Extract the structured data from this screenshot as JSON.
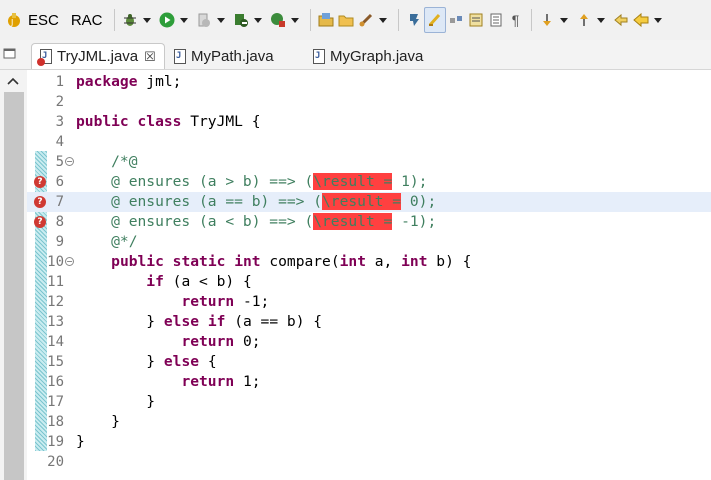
{
  "toolbar": {
    "esc_label": "ESC",
    "rac_label": "RAC"
  },
  "tabs": [
    {
      "label": "TryJML.java",
      "active": true,
      "has_error": true,
      "close_glyph": "☒"
    },
    {
      "label": "MyPath.java",
      "active": false
    },
    {
      "label": "MyGraph.java",
      "active": false
    }
  ],
  "editor": {
    "lines": [
      {
        "num": "1",
        "segments": [
          {
            "t": "kw",
            "v": "package"
          },
          {
            "t": "",
            "v": " jml;"
          }
        ]
      },
      {
        "num": "2",
        "segments": []
      },
      {
        "num": "3",
        "segments": [
          {
            "t": "kw",
            "v": "public"
          },
          {
            "t": "",
            "v": " "
          },
          {
            "t": "kw",
            "v": "class"
          },
          {
            "t": "",
            "v": " TryJML {"
          }
        ]
      },
      {
        "num": "4",
        "segments": []
      },
      {
        "num": "5",
        "segments": [
          {
            "t": "cm",
            "v": "    /*@"
          }
        ]
      },
      {
        "num": "6",
        "segments": [
          {
            "t": "cm",
            "v": "    @ ensures (a > b) ==> ("
          },
          {
            "t": "err",
            "v": "\\result ="
          },
          {
            "t": "cm",
            "v": " 1);"
          }
        ]
      },
      {
        "num": "7",
        "segments": [
          {
            "t": "cm",
            "v": "    @ ensures (a == b) ==> ("
          },
          {
            "t": "err",
            "v": "\\result ="
          },
          {
            "t": "cm",
            "v": " 0);"
          }
        ]
      },
      {
        "num": "8",
        "segments": [
          {
            "t": "cm",
            "v": "    @ ensures (a < b) ==> ("
          },
          {
            "t": "err",
            "v": "\\result ="
          },
          {
            "t": "cm",
            "v": " -1);"
          }
        ]
      },
      {
        "num": "9",
        "segments": [
          {
            "t": "cm",
            "v": "    @*/"
          }
        ]
      },
      {
        "num": "10",
        "segments": [
          {
            "t": "",
            "v": "    "
          },
          {
            "t": "kw",
            "v": "public"
          },
          {
            "t": "",
            "v": " "
          },
          {
            "t": "kw",
            "v": "static"
          },
          {
            "t": "",
            "v": " "
          },
          {
            "t": "kw",
            "v": "int"
          },
          {
            "t": "",
            "v": " compare("
          },
          {
            "t": "kw",
            "v": "int"
          },
          {
            "t": "",
            "v": " a, "
          },
          {
            "t": "kw",
            "v": "int"
          },
          {
            "t": "",
            "v": " b) {"
          }
        ]
      },
      {
        "num": "11",
        "segments": [
          {
            "t": "",
            "v": "        "
          },
          {
            "t": "kw",
            "v": "if"
          },
          {
            "t": "",
            "v": " (a < b) {"
          }
        ]
      },
      {
        "num": "12",
        "segments": [
          {
            "t": "",
            "v": "            "
          },
          {
            "t": "kw",
            "v": "return"
          },
          {
            "t": "",
            "v": " -1;"
          }
        ]
      },
      {
        "num": "13",
        "segments": [
          {
            "t": "",
            "v": "        } "
          },
          {
            "t": "kw",
            "v": "else"
          },
          {
            "t": "",
            "v": " "
          },
          {
            "t": "kw",
            "v": "if"
          },
          {
            "t": "",
            "v": " (a == b) {"
          }
        ]
      },
      {
        "num": "14",
        "segments": [
          {
            "t": "",
            "v": "            "
          },
          {
            "t": "kw",
            "v": "return"
          },
          {
            "t": "",
            "v": " 0;"
          }
        ]
      },
      {
        "num": "15",
        "segments": [
          {
            "t": "",
            "v": "        } "
          },
          {
            "t": "kw",
            "v": "else"
          },
          {
            "t": "",
            "v": " {"
          }
        ]
      },
      {
        "num": "16",
        "segments": [
          {
            "t": "",
            "v": "            "
          },
          {
            "t": "kw",
            "v": "return"
          },
          {
            "t": "",
            "v": " 1;"
          }
        ]
      },
      {
        "num": "17",
        "segments": [
          {
            "t": "",
            "v": "        }"
          }
        ]
      },
      {
        "num": "18",
        "segments": [
          {
            "t": "",
            "v": "    }"
          }
        ]
      },
      {
        "num": "19",
        "segments": [
          {
            "t": "",
            "v": "}"
          }
        ]
      },
      {
        "num": "20",
        "segments": []
      }
    ],
    "error_lines": [
      "6",
      "7",
      "8"
    ],
    "fold_lines": [
      "5",
      "10"
    ],
    "highlighted_line": "7"
  },
  "colors": {
    "keyword": "#7f0055",
    "comment": "#3f7f5f",
    "error_highlight": "#ff4040",
    "error_marker": "#cf3a33"
  }
}
